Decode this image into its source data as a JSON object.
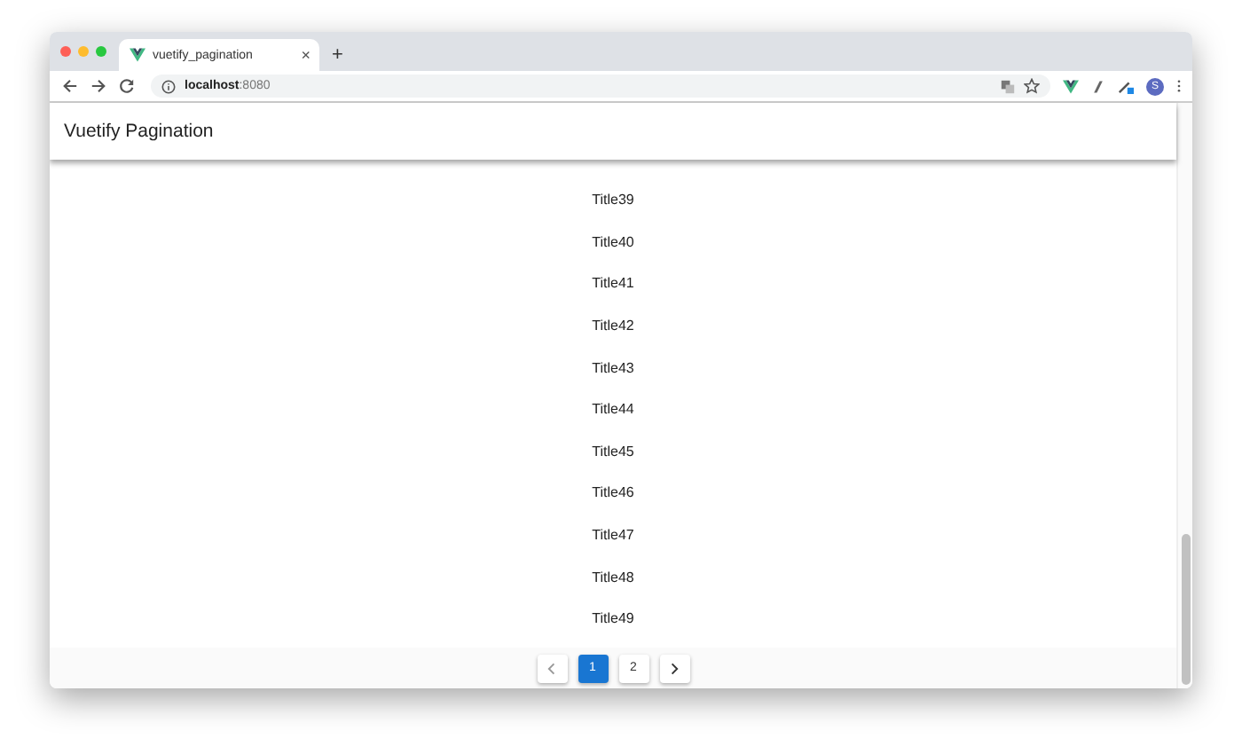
{
  "browser": {
    "tab": {
      "title": "vuetify_pagination",
      "close": "×"
    },
    "new_tab": "+",
    "address": {
      "host": "localhost",
      "port": ":8080"
    },
    "profile_initial": "S"
  },
  "app_bar": {
    "title": "Vuetify Pagination"
  },
  "items": [
    "Title39",
    "Title40",
    "Title41",
    "Title42",
    "Title43",
    "Title44",
    "Title45",
    "Title46",
    "Title47",
    "Title48",
    "Title49"
  ],
  "pagination": {
    "pages": [
      {
        "label": "1",
        "selected": true
      },
      {
        "label": "2",
        "selected": false
      }
    ]
  }
}
